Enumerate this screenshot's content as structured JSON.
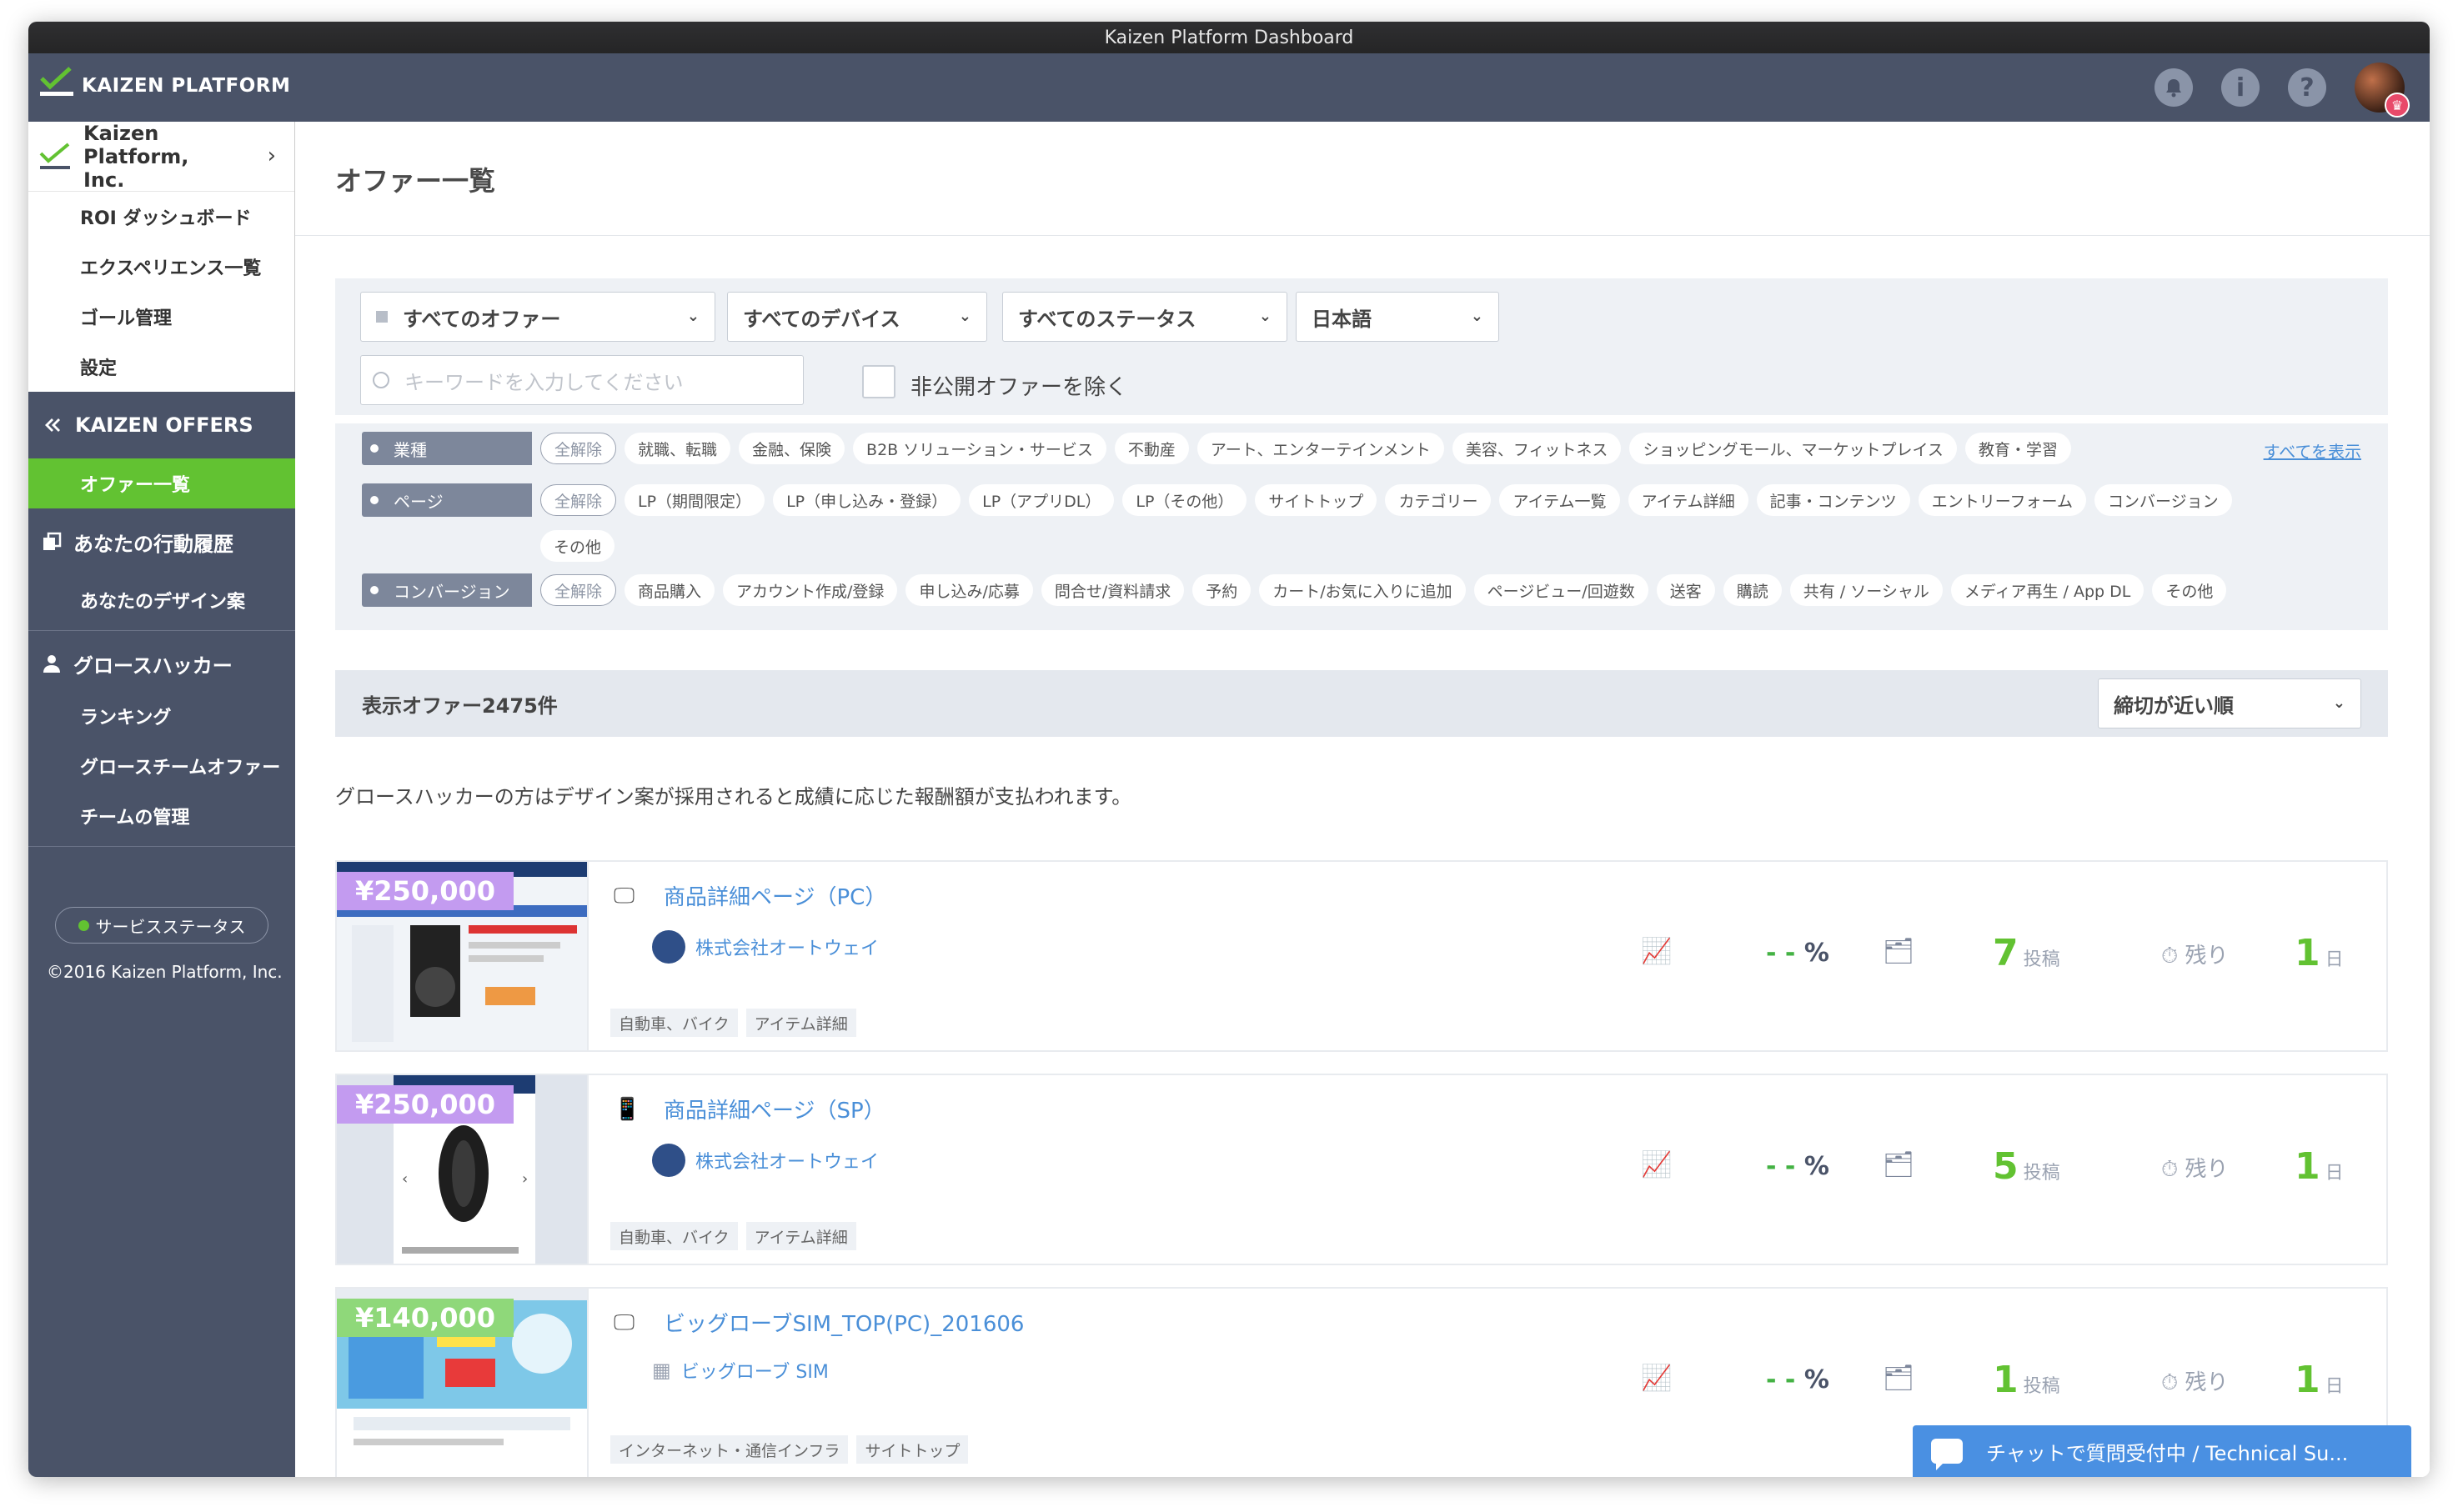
{
  "window": {
    "title": "Kaizen Platform Dashboard"
  },
  "brand": {
    "logo_text": "KAIZEN PLATFORM"
  },
  "topbar": {
    "icons": [
      "bell-icon",
      "info-icon",
      "help-icon"
    ],
    "avatar_badge": "crown-icon"
  },
  "sidebar": {
    "org_name": "Kaizen Platform, Inc.",
    "org_links": [
      {
        "label": "ROI ダッシュボード"
      },
      {
        "label": "エクスペリエンス一覧"
      },
      {
        "label": "ゴール管理"
      },
      {
        "label": "設定"
      }
    ],
    "offers_section": {
      "title": "KAIZEN OFFERS",
      "active_item": "オファー一覧"
    },
    "history_section": {
      "title": "あなたの行動履歴",
      "item": "あなたのデザイン案"
    },
    "hacker_section": {
      "title": "グロースハッカー",
      "items": [
        {
          "label": "ランキング"
        },
        {
          "label": "グロースチームオファー"
        },
        {
          "label": "チームの管理"
        }
      ]
    },
    "service_status": "サービスステータス",
    "copyright": "©2016 Kaizen Platform, Inc."
  },
  "page": {
    "title": "オファー一覧"
  },
  "filters": {
    "offer_select": "すべてのオファー",
    "device_select": "すべてのデバイス",
    "status_select": "すべてのステータス",
    "language_select": "日本語",
    "search_placeholder": "キーワードを入力してください",
    "exclude_private_label": "非公開オファーを除く",
    "exclude_private_checked": false
  },
  "tag_filters": {
    "clear_label": "全解除",
    "show_all": "すべてを表示",
    "industry": {
      "label": "業種",
      "tags": [
        "就職、転職",
        "金融、保険",
        "B2B ソリューション・サービス",
        "不動産",
        "アート、エンターテインメント",
        "美容、フィットネス",
        "ショッピングモール、マーケットプレイス",
        "教育・学習"
      ]
    },
    "page": {
      "label": "ページ",
      "tags": [
        "LP（期間限定）",
        "LP（申し込み・登録）",
        "LP（アプリDL）",
        "LP（その他）",
        "サイトトップ",
        "カテゴリー",
        "アイテム一覧",
        "アイテム詳細",
        "記事・コンテンツ",
        "エントリーフォーム",
        "コンバージョン",
        "その他"
      ]
    },
    "conversion": {
      "label": "コンバージョン",
      "tags": [
        "商品購入",
        "アカウント作成/登録",
        "申し込み/応募",
        "問合せ/資料請求",
        "予約",
        "カート/お気に入りに追加",
        "ページビュー/回遊数",
        "送客",
        "購読",
        "共有 / ソーシャル",
        "メディア再生 / App DL",
        "その他"
      ]
    }
  },
  "results": {
    "count_label": "表示オファー2475件",
    "sort_label": "締切が近い順"
  },
  "notice": "グロースハッカーの方はデザイン案が採用されると成績に応じた報酬額が支払われます。",
  "offers": [
    {
      "price": "¥250,000",
      "price_color": "#c39bf0",
      "device_icon": "monitor-icon",
      "title": "商品詳細ページ（PC）",
      "company": "株式会社オートウェイ",
      "tags": [
        "自動車、バイク",
        "アイテム詳細"
      ],
      "rate": "- -",
      "rate_unit": "%",
      "posts": "7",
      "posts_unit": "投稿",
      "remain_label": "残り",
      "days": "1",
      "days_unit": "日"
    },
    {
      "price": "¥250,000",
      "price_color": "#c39bf0",
      "device_icon": "smartphone-icon",
      "title": "商品詳細ページ（SP）",
      "company": "株式会社オートウェイ",
      "tags": [
        "自動車、バイク",
        "アイテム詳細"
      ],
      "rate": "- -",
      "rate_unit": "%",
      "posts": "5",
      "posts_unit": "投稿",
      "remain_label": "残り",
      "days": "1",
      "days_unit": "日"
    },
    {
      "price": "¥140,000",
      "price_color": "#8fd87a",
      "device_icon": "monitor-icon",
      "title": "ビッグローブSIM_TOP(PC)_201606",
      "company": "ビッグローブ SIM",
      "tags": [
        "インターネット・通信インフラ",
        "サイトトップ"
      ],
      "rate": "- -",
      "rate_unit": "%",
      "posts": "1",
      "posts_unit": "投稿",
      "remain_label": "残り",
      "days": "1",
      "days_unit": "日"
    }
  ],
  "chat": {
    "label": "チャットで質問受付中 / Technical Su..."
  },
  "colors": {
    "sidebar": "#4a5368",
    "accent_green": "#62c232",
    "link_blue": "#4a8fd8",
    "panel": "#eef1f5"
  }
}
